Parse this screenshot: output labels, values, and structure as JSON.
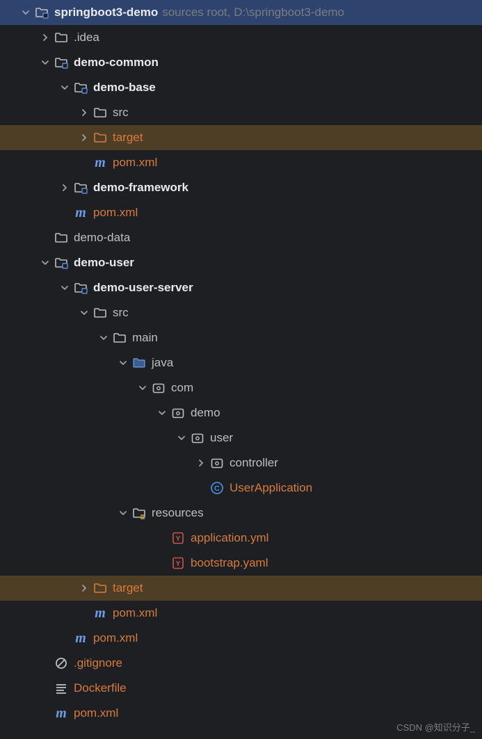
{
  "watermark": "CSDN @知识分子_",
  "rows": [
    {
      "depth": 0,
      "arrow": "down",
      "icon": "module",
      "label": "springboot3-demo",
      "bold": true,
      "tail": "  sources root,  D:\\springboot3-demo",
      "variant": "selected"
    },
    {
      "depth": 1,
      "arrow": "right",
      "icon": "folder",
      "label": ".idea"
    },
    {
      "depth": 1,
      "arrow": "down",
      "icon": "module",
      "label": "demo-common",
      "bold": true
    },
    {
      "depth": 2,
      "arrow": "down",
      "icon": "module",
      "label": "demo-base",
      "bold": true
    },
    {
      "depth": 3,
      "arrow": "right",
      "icon": "folder",
      "label": "src"
    },
    {
      "depth": 3,
      "arrow": "right",
      "icon": "folder-o",
      "label": "target",
      "color": "orange",
      "variant": "highlight"
    },
    {
      "depth": 3,
      "arrow": "none",
      "icon": "maven",
      "label": "pom.xml",
      "color": "orange"
    },
    {
      "depth": 2,
      "arrow": "right",
      "icon": "module",
      "label": "demo-framework",
      "bold": true
    },
    {
      "depth": 2,
      "arrow": "none",
      "icon": "maven",
      "label": "pom.xml",
      "color": "orange"
    },
    {
      "depth": 1,
      "arrow": "none",
      "icon": "folder",
      "label": "demo-data"
    },
    {
      "depth": 1,
      "arrow": "down",
      "icon": "module",
      "label": "demo-user",
      "bold": true
    },
    {
      "depth": 2,
      "arrow": "down",
      "icon": "module",
      "label": "demo-user-server",
      "bold": true
    },
    {
      "depth": 3,
      "arrow": "down",
      "icon": "folder",
      "label": "src"
    },
    {
      "depth": 4,
      "arrow": "down",
      "icon": "folder",
      "label": "main"
    },
    {
      "depth": 5,
      "arrow": "down",
      "icon": "src-folder",
      "label": "java"
    },
    {
      "depth": 6,
      "arrow": "down",
      "icon": "package",
      "label": "com"
    },
    {
      "depth": 7,
      "arrow": "down",
      "icon": "package",
      "label": "demo"
    },
    {
      "depth": 8,
      "arrow": "down",
      "icon": "package",
      "label": "user"
    },
    {
      "depth": 9,
      "arrow": "right",
      "icon": "package",
      "label": "controller"
    },
    {
      "depth": 9,
      "arrow": "none",
      "icon": "class",
      "label": "UserApplication",
      "color": "orange"
    },
    {
      "depth": 5,
      "arrow": "down",
      "icon": "resources",
      "label": "resources"
    },
    {
      "depth": 7,
      "arrow": "none",
      "icon": "yaml",
      "label": "application.yml",
      "color": "orange"
    },
    {
      "depth": 7,
      "arrow": "none",
      "icon": "yaml",
      "label": "bootstrap.yaml",
      "color": "orange"
    },
    {
      "depth": 3,
      "arrow": "right",
      "icon": "folder-o",
      "label": "target",
      "color": "orange",
      "variant": "highlight"
    },
    {
      "depth": 3,
      "arrow": "none",
      "icon": "maven",
      "label": "pom.xml",
      "color": "orange"
    },
    {
      "depth": 2,
      "arrow": "none",
      "icon": "maven",
      "label": "pom.xml",
      "color": "orange"
    },
    {
      "depth": 1,
      "arrow": "none",
      "icon": "gitignore",
      "label": ".gitignore",
      "color": "orange"
    },
    {
      "depth": 1,
      "arrow": "none",
      "icon": "docker",
      "label": "Dockerfile",
      "color": "orange"
    },
    {
      "depth": 1,
      "arrow": "none",
      "icon": "maven",
      "label": "pom.xml",
      "color": "orange"
    }
  ]
}
